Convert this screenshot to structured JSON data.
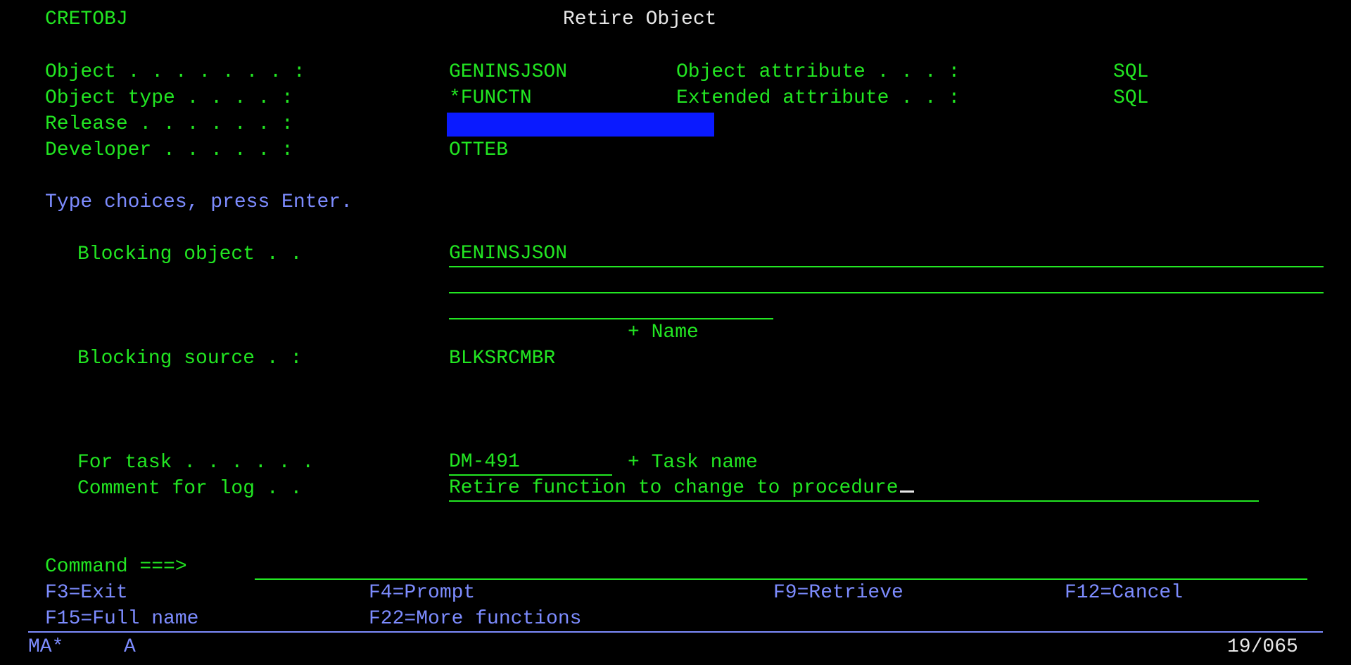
{
  "header": {
    "program": "CRETOBJ",
    "title": "Retire Object"
  },
  "info": {
    "object_label": "Object . . . . . . . :",
    "object_value": "GENINSJSON",
    "object_attr_label": "Object attribute . . . :",
    "object_attr_value": "SQL",
    "object_type_label": "Object type . . . . :",
    "object_type_value": "*FUNCTN",
    "ext_attr_label": "Extended attribute . . :",
    "ext_attr_value": "SQL",
    "release_label": "Release . . . . . . :",
    "release_value": "",
    "developer_label": "Developer . . . . . :",
    "developer_value": "OTTEB"
  },
  "instructions": "Type choices, press Enter.",
  "form": {
    "blocking_object_label": "Blocking object . .",
    "blocking_object_value_1": "GENINSJSON",
    "blocking_object_value_2": "",
    "blocking_object_value_3": "",
    "name_hint": "+ Name",
    "blocking_source_label": "Blocking source . :",
    "blocking_source_value": "BLKSRCMBR",
    "for_task_label": "For task . . . . . .",
    "for_task_value": "DM-491",
    "task_name_hint": "+ Task name",
    "comment_label": "Comment for log . .",
    "comment_value": "Retire function to change to procedure"
  },
  "command": {
    "label": "Command ===>",
    "value": ""
  },
  "function_keys": {
    "f3": "F3=Exit",
    "f4": "F4=Prompt",
    "f9": "F9=Retrieve",
    "f12": "F12=Cancel",
    "f15": "F15=Full name",
    "f22": "F22=More functions"
  },
  "status": {
    "session": "MA*",
    "mode": "A",
    "cursor_pos": "19/065"
  },
  "colors": {
    "field_text": "#22e622",
    "prompt_text": "#7d8cff",
    "title_text": "#e8e8e8",
    "release_highlight": "#0a1aff",
    "background": "#000000"
  }
}
